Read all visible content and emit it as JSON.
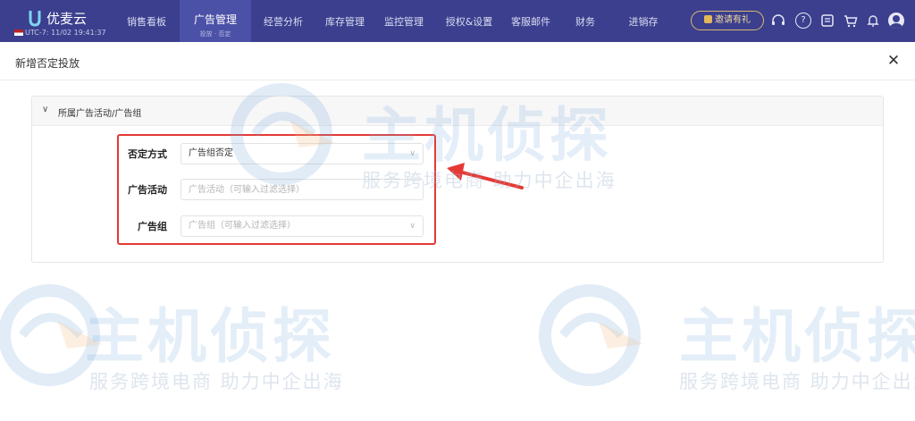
{
  "app": {
    "name": "优麦云",
    "timezone": "UTC-7: 11/02 19:41:37"
  },
  "nav": {
    "items": [
      {
        "label": "销售看板"
      },
      {
        "label": "广告管理",
        "sub": "投放 · 否定",
        "active": true
      },
      {
        "label": "经营分析"
      },
      {
        "label": "库存管理"
      },
      {
        "label": "监控管理"
      },
      {
        "label": "授权&设置"
      },
      {
        "label": "客服邮件"
      },
      {
        "label": "财务"
      },
      {
        "label": "进销存"
      }
    ],
    "invite_label": "邀请有礼"
  },
  "dialog": {
    "title": "新增否定投放",
    "close_icon": "✕",
    "section_title": "所属广告活动/广告组",
    "form": {
      "negation_mode": {
        "label": "否定方式",
        "value": "广告组否定"
      },
      "campaign": {
        "label": "广告活动",
        "placeholder": "广告活动（可输入过滤选择）"
      },
      "ad_group": {
        "label": "广告组",
        "placeholder": "广告组（可输入过滤选择）"
      }
    }
  },
  "watermark": {
    "brand": "主机侦探",
    "slogan": "服务跨境电商  助力中企出海"
  },
  "colors": {
    "topbar": "#3b3f8e",
    "active_nav": "#4c51a8",
    "highlight": "#e53935",
    "invite_border": "#d9b871"
  }
}
